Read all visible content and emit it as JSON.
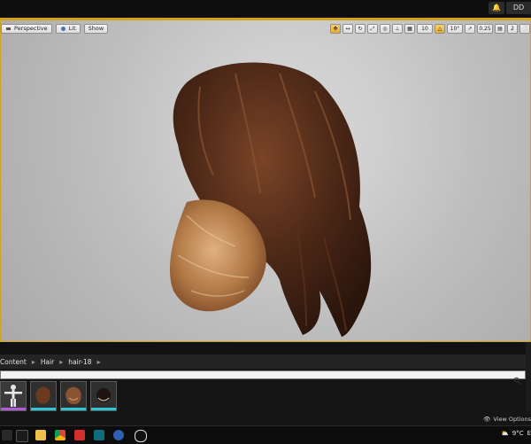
{
  "window": {
    "top_right_label": "DD"
  },
  "viewport": {
    "toolbar_left": {
      "perspective": "Perspective",
      "lit": "Lit",
      "show": "Show"
    },
    "toolbar_right": {
      "grid_size": "10",
      "rotation": "10°",
      "scale": "0.25",
      "camera_speed": "2"
    }
  },
  "content_browser": {
    "breadcrumb": [
      "Content",
      "Hair",
      "hair-18"
    ],
    "search": {
      "value": "",
      "placeholder": ""
    },
    "view_options": "View Options"
  },
  "taskbar": {
    "weather": "9°C",
    "lang": "E"
  },
  "colors": {
    "accent": "#d2a21a",
    "hair_dark": "#3b1f12",
    "hair_mid": "#6b3a1e",
    "hair_light": "#b07845"
  }
}
